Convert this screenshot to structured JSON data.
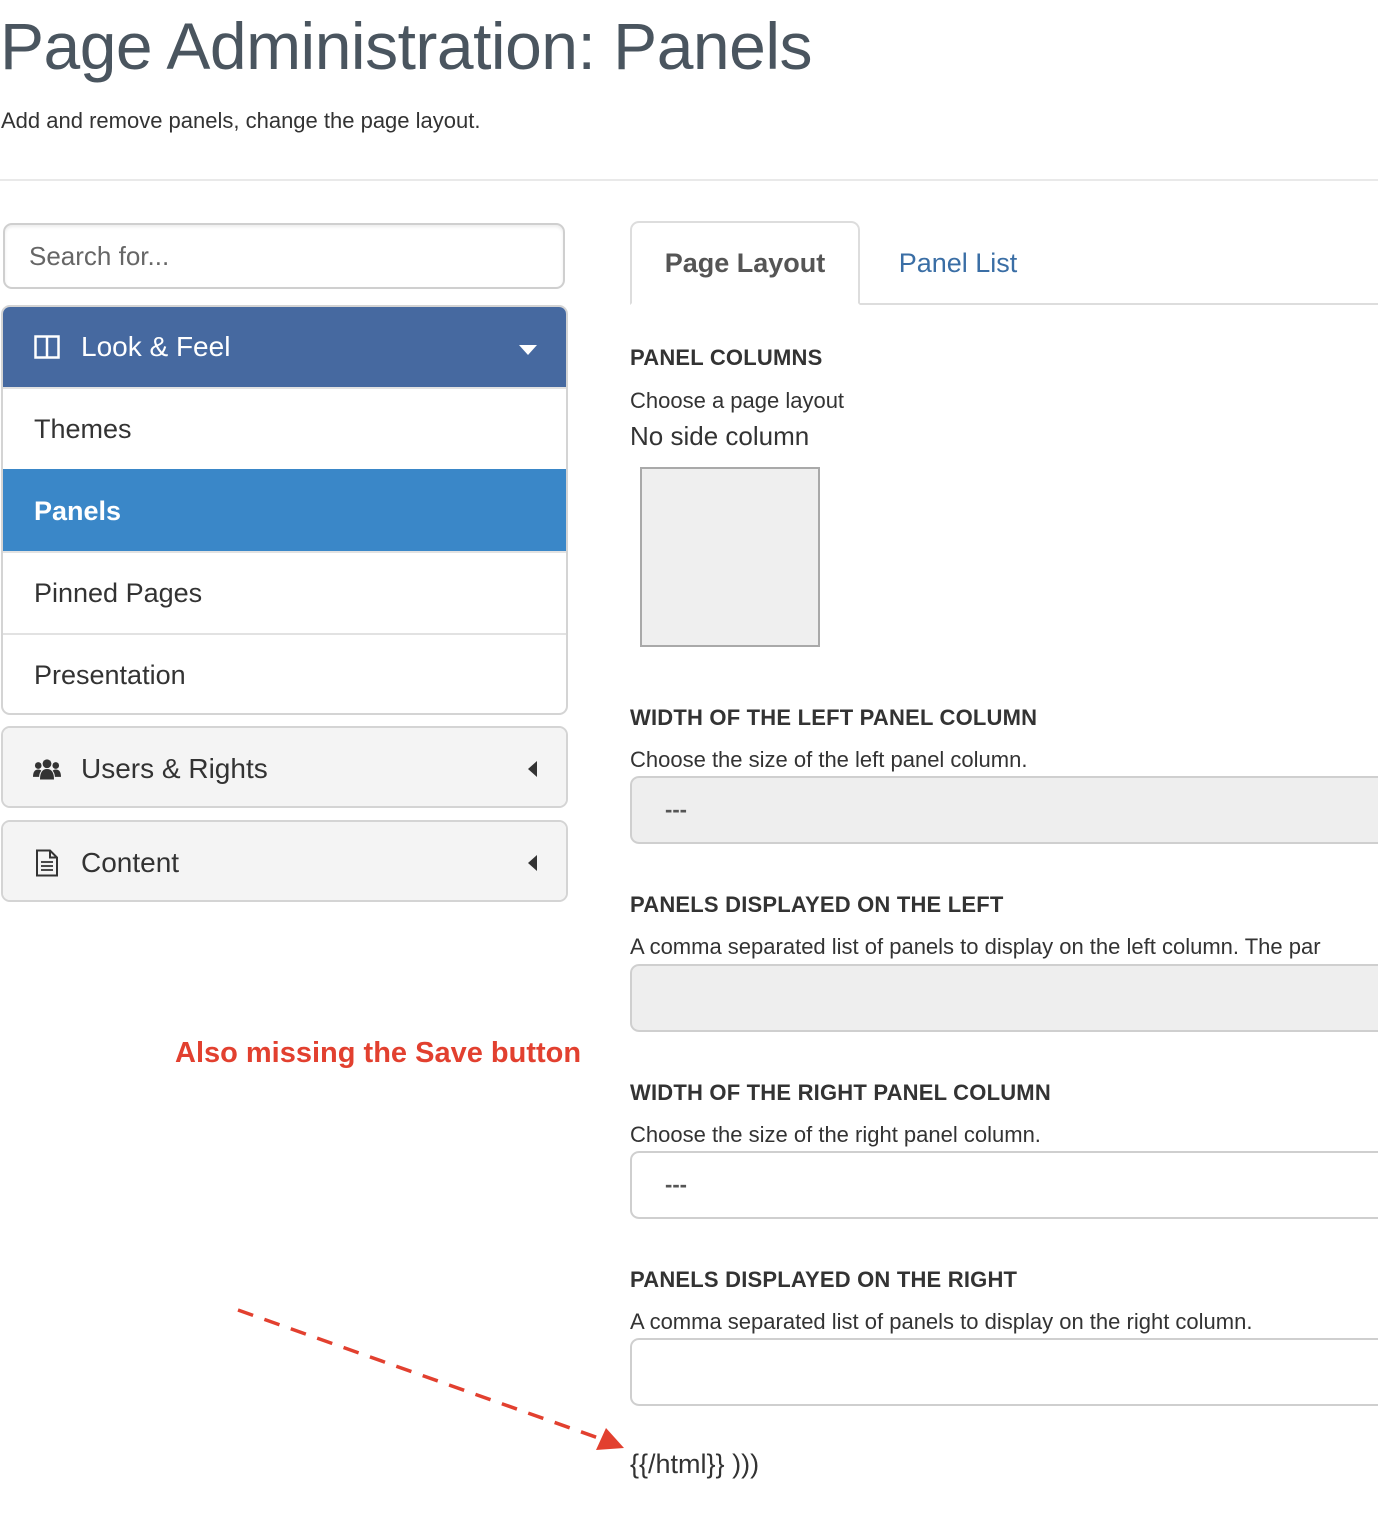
{
  "header": {
    "title": "Page Administration: Panels",
    "subtitle": "Add and remove panels, change the page layout."
  },
  "sidebar": {
    "search_placeholder": "Search for...",
    "look_and_feel": {
      "label": "Look & Feel",
      "icon": "columns-icon",
      "items": [
        {
          "label": "Themes",
          "selected": false
        },
        {
          "label": "Panels",
          "selected": true
        },
        {
          "label": "Pinned Pages",
          "selected": false
        },
        {
          "label": "Presentation",
          "selected": false
        }
      ]
    },
    "users_and_rights": {
      "label": "Users & Rights",
      "icon": "users-icon"
    },
    "content": {
      "label": "Content",
      "icon": "document-icon"
    }
  },
  "annotation": {
    "note": "Also missing the Save button",
    "color": "#e2402f"
  },
  "tabs": [
    {
      "label": "Page Layout",
      "active": true
    },
    {
      "label": "Panel List",
      "active": false
    }
  ],
  "form": {
    "panel_columns": {
      "heading": "PANEL COLUMNS",
      "description": "Choose a page layout",
      "layout_name": "No side column"
    },
    "left_width": {
      "heading": "WIDTH OF THE LEFT PANEL COLUMN",
      "description": "Choose the size of the left panel column.",
      "value": "---"
    },
    "left_panels": {
      "heading": "PANELS DISPLAYED ON THE LEFT",
      "description": "A comma separated list of panels to display on the left column. The par",
      "value": ""
    },
    "right_width": {
      "heading": "WIDTH OF THE RIGHT PANEL COLUMN",
      "description": "Choose the size of the right panel column.",
      "value": "---"
    },
    "right_panels": {
      "heading": "PANELS DISPLAYED ON THE RIGHT",
      "description": "A comma separated list of panels to display on the right column.",
      "value": ""
    }
  },
  "footer_text": "{{/html}} )))",
  "colors": {
    "accent_dark": "#4669a0",
    "accent_selected": "#3a87c8",
    "link": "#3a6ea5",
    "annotation": "#e2402f"
  }
}
